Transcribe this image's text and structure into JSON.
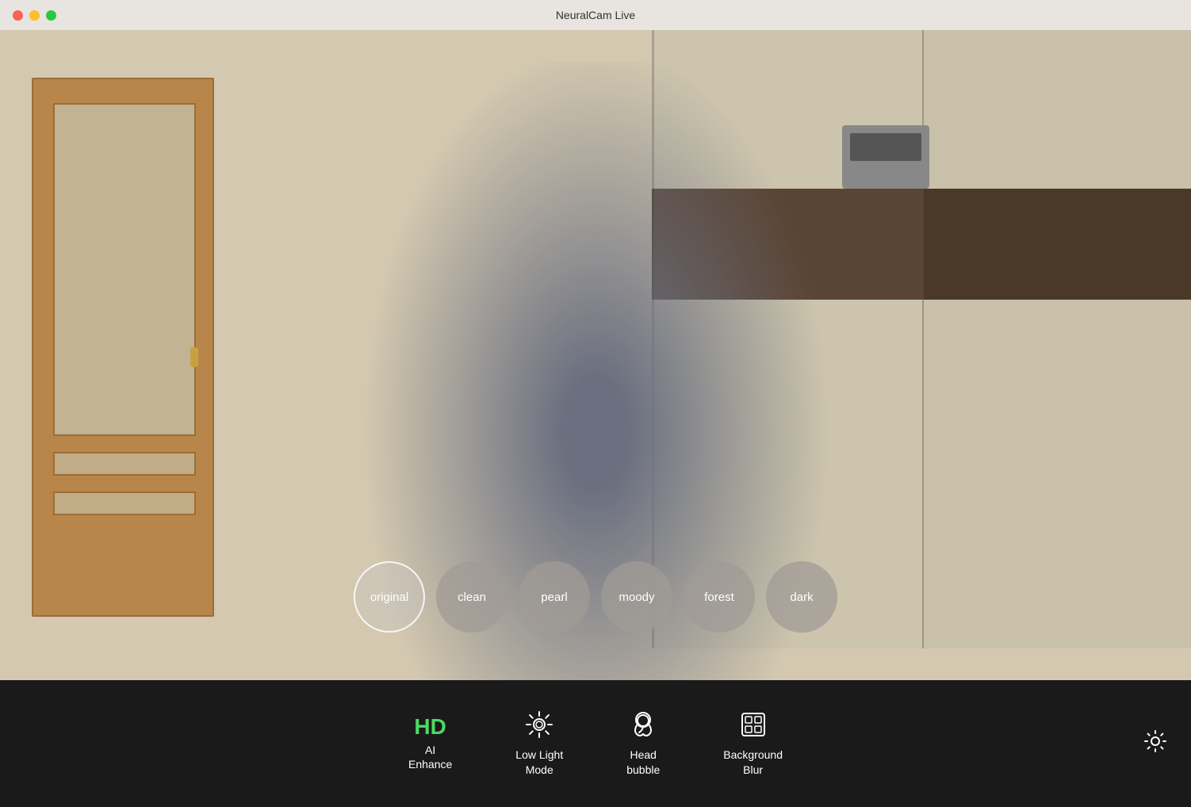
{
  "titlebar": {
    "title": "NeuralCam Live"
  },
  "window_controls": {
    "close_label": "",
    "minimize_label": "",
    "maximize_label": ""
  },
  "filters": [
    {
      "id": "original",
      "label": "original",
      "active": true
    },
    {
      "id": "clean",
      "label": "clean",
      "active": false
    },
    {
      "id": "pearl",
      "label": "pearl",
      "active": false
    },
    {
      "id": "moody",
      "label": "moody",
      "active": false
    },
    {
      "id": "forest",
      "label": "forest",
      "active": false
    },
    {
      "id": "dark",
      "label": "dark",
      "active": false
    }
  ],
  "toolbar": {
    "ai_enhance_label_top": "HD",
    "ai_enhance_label": "AI\nEnhance",
    "low_light_label": "Low Light\nMode",
    "head_bubble_label": "Head\nbubble",
    "background_blur_label": "Background\nBlur"
  },
  "colors": {
    "accent_green": "#4cd964",
    "toolbar_bg": "#1a1a1a",
    "titlebar_bg": "#e8e4df"
  }
}
